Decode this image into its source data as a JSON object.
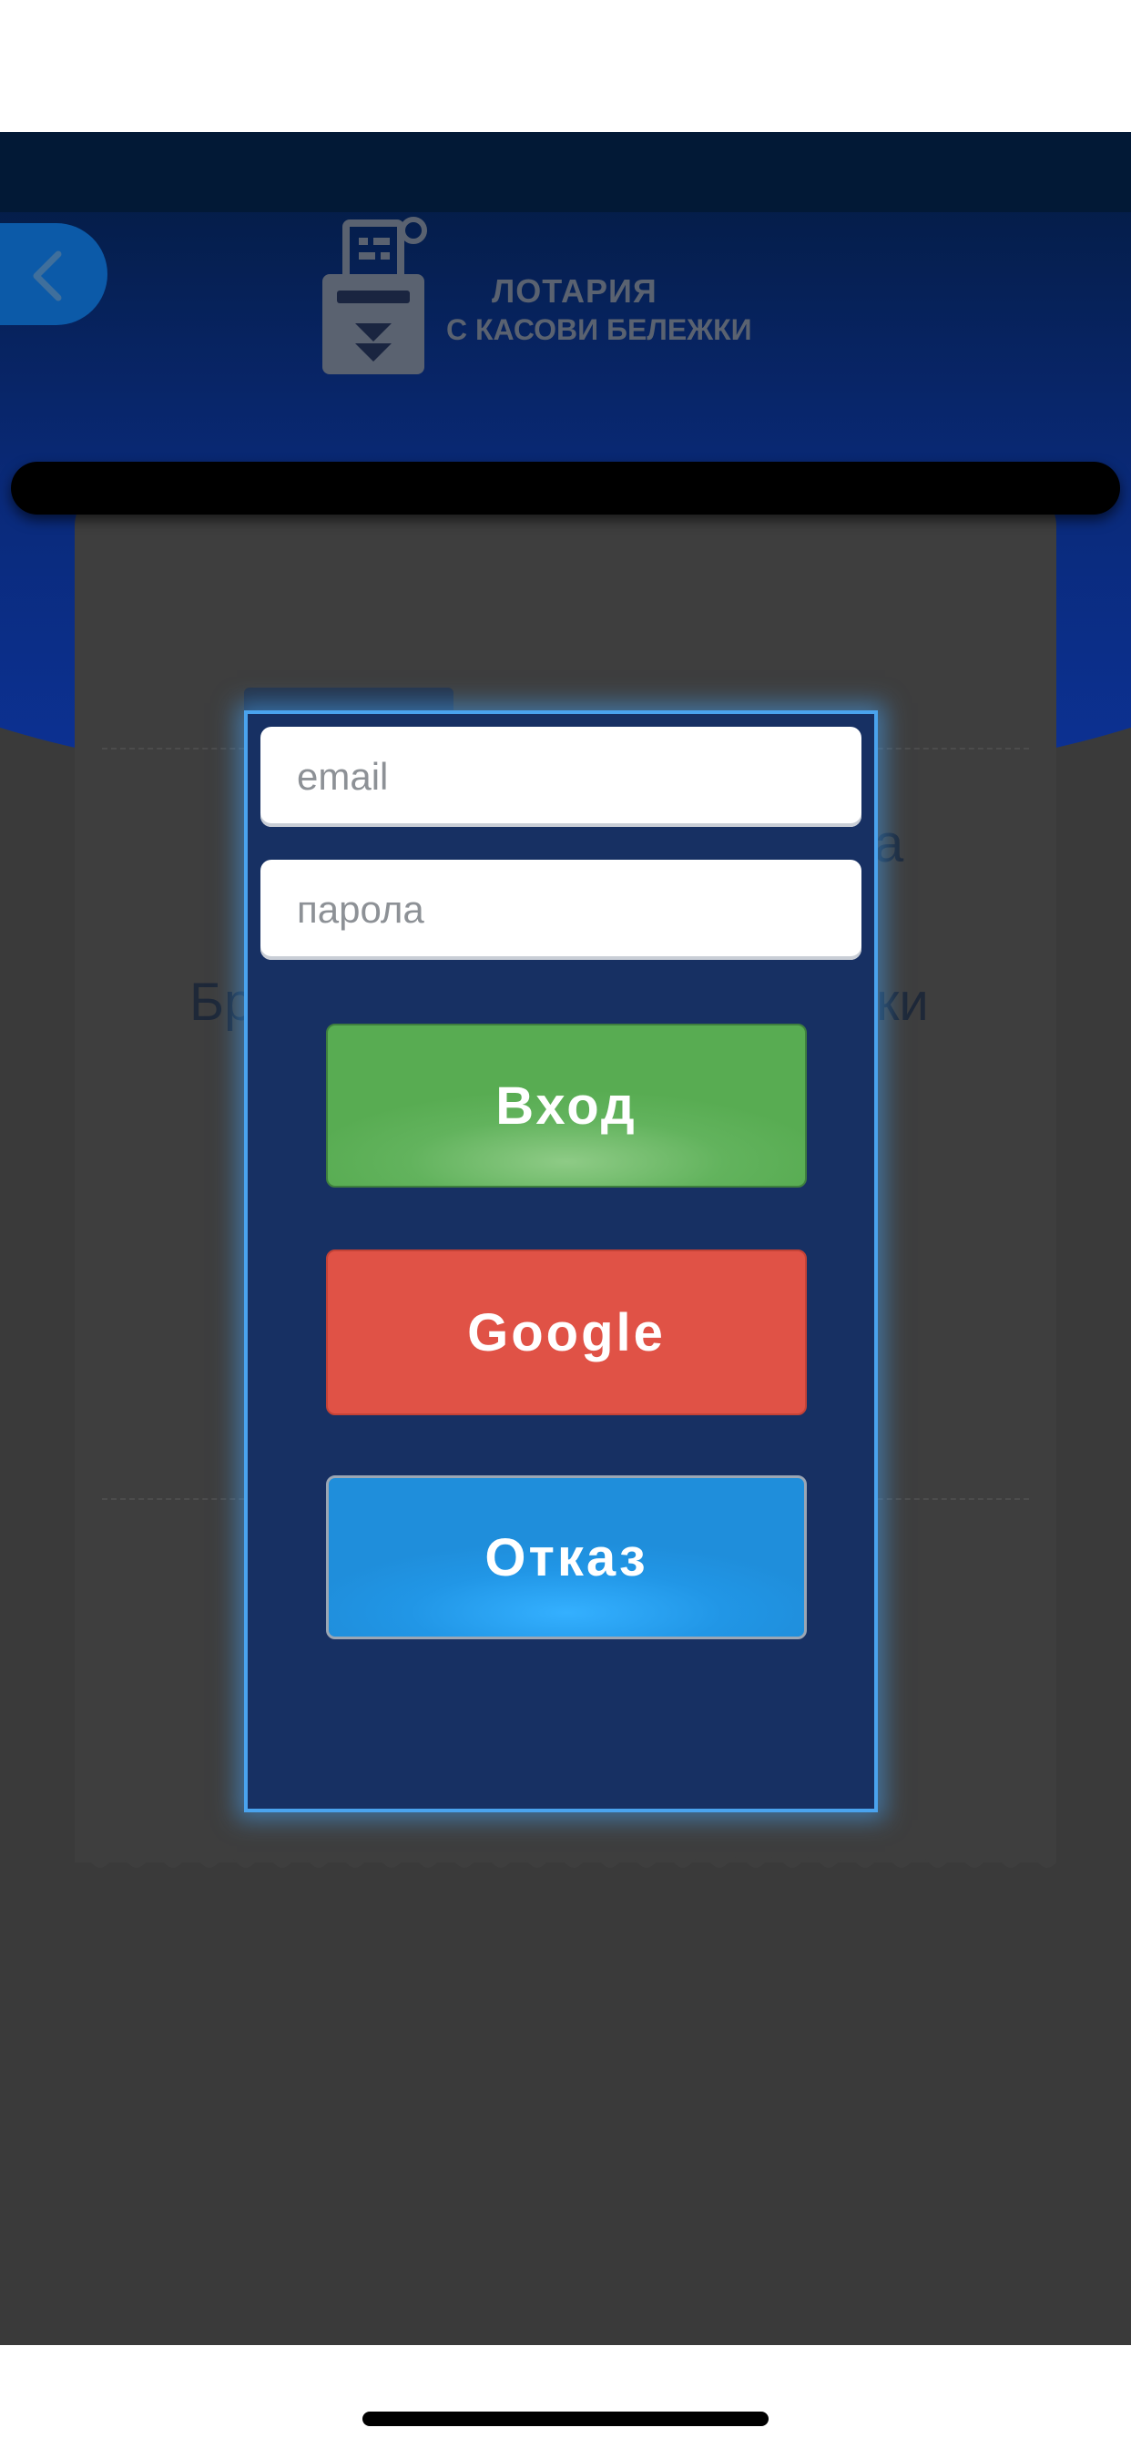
{
  "header": {
    "logo_line1": "ЛОТАРИЯ",
    "logo_line2": "С КАСОВИ БЕЛЕЖКИ",
    "back_icon": "chevron-left-icon",
    "logo_icon": "receipt-machine-icon"
  },
  "receipt": {
    "line1_suffix": "а",
    "line2_prefix": "Бр",
    "line2_suffix": "ки"
  },
  "login_dialog": {
    "email_placeholder": "email",
    "password_placeholder": "парола",
    "login_label": "Вход",
    "google_label": "Google",
    "cancel_label": "Отказ"
  },
  "colors": {
    "dialog_bg": "#173063",
    "dialog_border": "#4aa3ee",
    "login_green": "#5cb057",
    "google_red": "#e05246",
    "cancel_blue": "#2196e6"
  }
}
